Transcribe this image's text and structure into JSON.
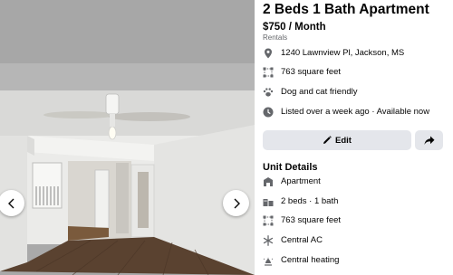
{
  "listing": {
    "title": "2 Beds 1 Bath Apartment",
    "price": "$750 / Month",
    "category": "Rentals"
  },
  "summary": [
    {
      "icon": "location-pin-icon",
      "text": "1240 Lawnview Pl, Jackson, MS"
    },
    {
      "icon": "square-feet-icon",
      "text": "763 square feet"
    },
    {
      "icon": "paw-icon",
      "text": "Dog and cat friendly"
    },
    {
      "icon": "clock-icon",
      "text": "Listed over a week ago · Available now"
    }
  ],
  "actions": {
    "edit_label": "Edit",
    "share_icon": "share-arrow-icon"
  },
  "unit_details": {
    "title": "Unit Details",
    "items": [
      {
        "icon": "building-icon",
        "text": "Apartment"
      },
      {
        "icon": "bed-bath-icon",
        "text": "2 beds · 1 bath"
      },
      {
        "icon": "square-feet-icon",
        "text": "763 square feet"
      },
      {
        "icon": "snowflake-icon",
        "text": "Central AC"
      },
      {
        "icon": "heating-icon",
        "text": "Central heating"
      }
    ]
  },
  "viewer": {
    "prev_icon": "chevron-left-icon",
    "next_icon": "chevron-right-icon"
  },
  "colors": {
    "icon_gray": "#65676b",
    "button_gray": "#e4e6eb",
    "text": "#050505"
  }
}
